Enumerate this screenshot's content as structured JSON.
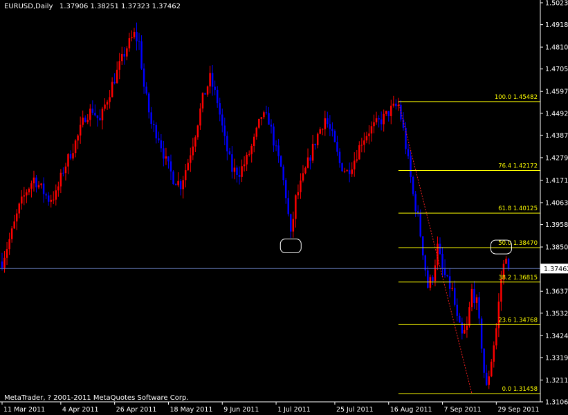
{
  "header": {
    "symbol_tf": "EURUSD,Daily",
    "ohlc": "1.37906 1.38251 1.37323 1.37462"
  },
  "copyright": "MetaTrader, ? 2001-2011 MetaQuotes Software Corp.",
  "colors": {
    "background": "#000000",
    "bull_candle": "#ff0000",
    "bear_candle": "#0000ff",
    "fib_line": "#ffff00",
    "current_price_line": "#6a7fc0",
    "grid_text": "#ffffff"
  },
  "chart_data": {
    "type": "candlestick",
    "title": "EURUSD,Daily",
    "y_ticks": [
      "1.50230",
      "1.49180",
      "1.48100",
      "1.47050",
      "1.45970",
      "1.44920",
      "1.43870",
      "1.42790",
      "1.41710",
      "1.40630",
      "1.39580",
      "1.38500",
      "1.37462",
      "1.36370",
      "1.35320",
      "1.34240",
      "1.33190",
      "1.32110",
      "1.31060"
    ],
    "y_tick_values": [
      1.5023,
      1.4918,
      1.481,
      1.4705,
      1.4597,
      1.4492,
      1.4387,
      1.4279,
      1.4171,
      1.4063,
      1.3958,
      1.385,
      1.37462,
      1.3637,
      1.3532,
      1.3424,
      1.3319,
      1.3211,
      1.3106
    ],
    "ylim": [
      1.3106,
      1.5023
    ],
    "x_ticks": [
      "11 Mar 2011",
      "4 Apr 2011",
      "26 Apr 2011",
      "18 May 2011",
      "9 Jun 2011",
      "1 Jul 2011",
      "25 Jul 2011",
      "16 Aug 2011",
      "7 Sep 2011",
      "29 Sep 2011"
    ],
    "x_tick_days": [
      0,
      24,
      46,
      68,
      90,
      112,
      136,
      158,
      180,
      202
    ],
    "xlim_days": [
      0,
      220
    ],
    "current_price": 1.37462,
    "current_price_label": "1.37462",
    "fib_levels": [
      {
        "label": "100.0",
        "value": 1.45482,
        "value_label": "1.45482"
      },
      {
        "label": "76.4",
        "value": 1.42172,
        "value_label": "1.42172"
      },
      {
        "label": "61.8",
        "value": 1.40125,
        "value_label": "1.40125"
      },
      {
        "label": "50.0",
        "value": 1.3847,
        "value_label": "1.38470"
      },
      {
        "label": "38.2",
        "value": 1.36815,
        "value_label": "1.36815"
      },
      {
        "label": "23.6",
        "value": 1.34768,
        "value_label": "1.34768"
      },
      {
        "label": "0.0",
        "value": 1.31458,
        "value_label": "1.31458"
      }
    ],
    "fib_range_days": [
      162,
      220
    ],
    "trendline": [
      [
        162,
        1.45482
      ],
      [
        192,
        1.31458
      ]
    ],
    "highlight_marks": [
      {
        "day": 118,
        "price": 1.3855
      },
      {
        "day": 204,
        "price": 1.385
      }
    ],
    "price_path": [
      [
        0,
        1.378
      ],
      [
        4,
        1.392
      ],
      [
        7,
        1.404
      ],
      [
        10,
        1.412
      ],
      [
        13,
        1.418
      ],
      [
        16,
        1.413
      ],
      [
        19,
        1.408
      ],
      [
        22,
        1.41
      ],
      [
        25,
        1.422
      ],
      [
        28,
        1.43
      ],
      [
        31,
        1.438
      ],
      [
        34,
        1.448
      ],
      [
        37,
        1.451
      ],
      [
        40,
        1.445
      ],
      [
        42,
        1.453
      ],
      [
        45,
        1.463
      ],
      [
        48,
        1.472
      ],
      [
        51,
        1.481
      ],
      [
        54,
        1.487
      ],
      [
        56,
        1.483
      ],
      [
        58,
        1.462
      ],
      [
        61,
        1.444
      ],
      [
        64,
        1.438
      ],
      [
        67,
        1.426
      ],
      [
        70,
        1.418
      ],
      [
        73,
        1.415
      ],
      [
        76,
        1.426
      ],
      [
        79,
        1.44
      ],
      [
        82,
        1.456
      ],
      [
        85,
        1.466
      ],
      [
        88,
        1.455
      ],
      [
        91,
        1.436
      ],
      [
        94,
        1.422
      ],
      [
        97,
        1.421
      ],
      [
        100,
        1.427
      ],
      [
        103,
        1.436
      ],
      [
        106,
        1.448
      ],
      [
        109,
        1.446
      ],
      [
        112,
        1.431
      ],
      [
        114,
        1.423
      ],
      [
        116,
        1.41
      ],
      [
        118,
        1.39
      ],
      [
        120,
        1.408
      ],
      [
        123,
        1.418
      ],
      [
        126,
        1.429
      ],
      [
        129,
        1.439
      ],
      [
        132,
        1.447
      ],
      [
        135,
        1.438
      ],
      [
        138,
        1.425
      ],
      [
        141,
        1.421
      ],
      [
        144,
        1.427
      ],
      [
        147,
        1.436
      ],
      [
        150,
        1.441
      ],
      [
        153,
        1.444
      ],
      [
        156,
        1.447
      ],
      [
        159,
        1.451
      ],
      [
        162,
        1.453
      ],
      [
        164,
        1.441
      ],
      [
        166,
        1.426
      ],
      [
        168,
        1.41
      ],
      [
        170,
        1.399
      ],
      [
        172,
        1.383
      ],
      [
        174,
        1.366
      ],
      [
        176,
        1.371
      ],
      [
        178,
        1.385
      ],
      [
        180,
        1.374
      ],
      [
        182,
        1.368
      ],
      [
        184,
        1.364
      ],
      [
        186,
        1.35
      ],
      [
        188,
        1.342
      ],
      [
        190,
        1.346
      ],
      [
        192,
        1.364
      ],
      [
        194,
        1.358
      ],
      [
        196,
        1.338
      ],
      [
        197,
        1.325
      ],
      [
        198,
        1.317
      ],
      [
        200,
        1.331
      ],
      [
        202,
        1.346
      ],
      [
        204,
        1.37
      ],
      [
        206,
        1.382
      ],
      [
        207,
        1.37462
      ]
    ]
  }
}
